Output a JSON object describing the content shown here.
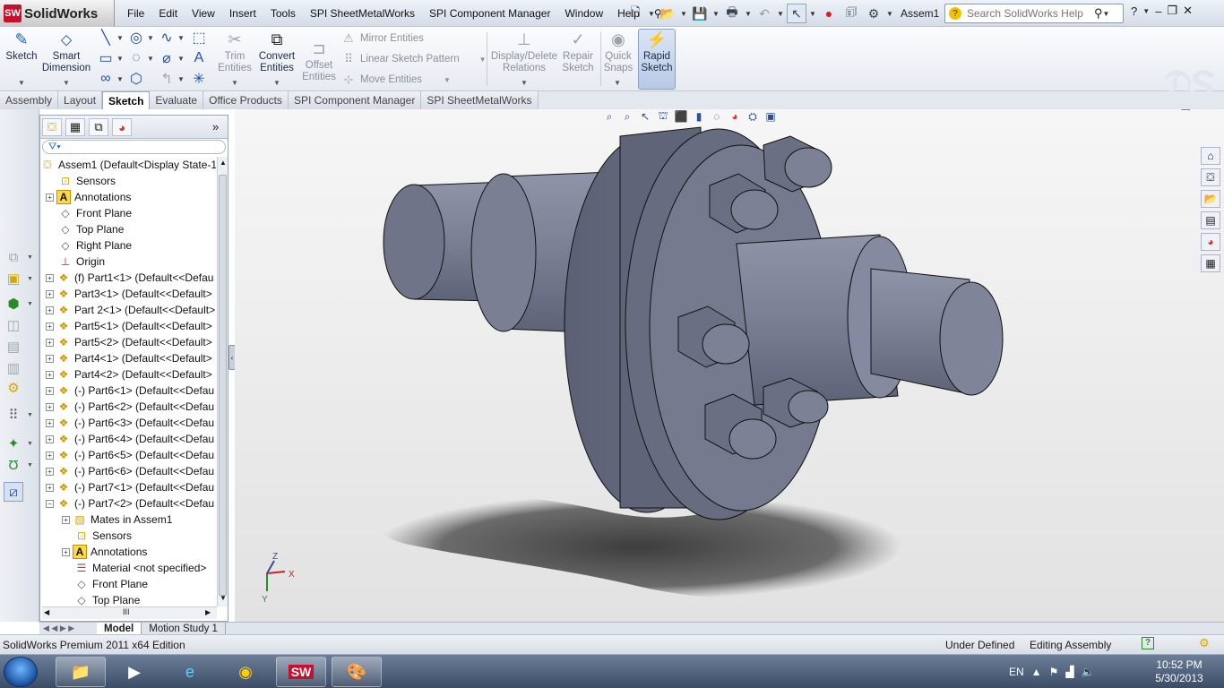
{
  "app": {
    "brand": "SolidWorks",
    "logo_letters": "SW"
  },
  "menu": [
    "File",
    "Edit",
    "View",
    "Insert",
    "Tools",
    "SPI SheetMetalWorks",
    "SPI Component Manager",
    "Window",
    "Help"
  ],
  "document_title": "Assem1",
  "search": {
    "placeholder": "Search SolidWorks Help"
  },
  "ribbon": {
    "sketch": "Sketch",
    "smart_dimension_1": "Smart",
    "smart_dimension_2": "Dimension",
    "trim_1": "Trim",
    "trim_2": "Entities",
    "convert_1": "Convert",
    "convert_2": "Entities",
    "offset_1": "Offset",
    "offset_2": "Entities",
    "mirror": "Mirror Entities",
    "linear_pattern": "Linear Sketch Pattern",
    "move": "Move Entities",
    "display_delete_1": "Display/Delete",
    "display_delete_2": "Relations",
    "repair_1": "Repair",
    "repair_2": "Sketch",
    "quick_snaps_1": "Quick",
    "quick_snaps_2": "Snaps",
    "rapid_1": "Rapid",
    "rapid_2": "Sketch"
  },
  "command_tabs": [
    "Assembly",
    "Layout",
    "Sketch",
    "Evaluate",
    "Office Products",
    "SPI Component Manager",
    "SPI SheetMetalWorks"
  ],
  "active_tab": "Sketch",
  "tree": {
    "root": "Assem1  (Default<Display State-1",
    "items": [
      {
        "label": "Sensors",
        "icon": "sensor-icon"
      },
      {
        "label": "Annotations",
        "icon": "annotations-icon"
      },
      {
        "label": "Front Plane",
        "icon": "plane-icon"
      },
      {
        "label": "Top Plane",
        "icon": "plane-icon"
      },
      {
        "label": "Right Plane",
        "icon": "plane-icon"
      },
      {
        "label": "Origin",
        "icon": "origin-icon"
      },
      {
        "label": "(f) Part1<1> (Default<<Defau",
        "icon": "part-icon"
      },
      {
        "label": "Part3<1> (Default<<Default>",
        "icon": "part-icon"
      },
      {
        "label": "Part 2<1> (Default<<Default>",
        "icon": "part-icon"
      },
      {
        "label": "Part5<1> (Default<<Default>",
        "icon": "part-icon"
      },
      {
        "label": "Part5<2> (Default<<Default>",
        "icon": "part-icon"
      },
      {
        "label": "Part4<1> (Default<<Default>",
        "icon": "part-icon"
      },
      {
        "label": "Part4<2> (Default<<Default>",
        "icon": "part-icon"
      },
      {
        "label": "(-) Part6<1> (Default<<Defau",
        "icon": "part-icon"
      },
      {
        "label": "(-) Part6<2> (Default<<Defau",
        "icon": "part-icon"
      },
      {
        "label": "(-) Part6<3> (Default<<Defau",
        "icon": "part-icon"
      },
      {
        "label": "(-) Part6<4> (Default<<Defau",
        "icon": "part-icon"
      },
      {
        "label": "(-) Part6<5> (Default<<Defau",
        "icon": "part-icon"
      },
      {
        "label": "(-) Part6<6> (Default<<Defau",
        "icon": "part-icon"
      },
      {
        "label": "(-) Part7<1> (Default<<Defau",
        "icon": "part-icon"
      },
      {
        "label": "(-) Part7<2> (Default<<Defau",
        "icon": "part-icon"
      }
    ],
    "sub_items": [
      {
        "label": "Mates in Assem1",
        "icon": "mates-icon"
      },
      {
        "label": "Sensors",
        "icon": "sensor-icon"
      },
      {
        "label": "Annotations",
        "icon": "annotations-icon"
      },
      {
        "label": "Material <not specified>",
        "icon": "material-icon"
      },
      {
        "label": "Front Plane",
        "icon": "plane-icon"
      },
      {
        "label": "Top Plane",
        "icon": "plane-icon"
      }
    ]
  },
  "bottom_tabs": [
    "Model",
    "Motion Study 1"
  ],
  "status": {
    "edition": "SolidWorks Premium 2011 x64 Edition",
    "state": "Under Defined",
    "mode": "Editing Assembly"
  },
  "triad": {
    "x": "X",
    "y": "Y",
    "z": "Z"
  },
  "tray": {
    "lang": "EN",
    "time": "10:52 PM",
    "date": "5/30/2013"
  },
  "colors": {
    "part": "#7b7f93",
    "part_dark": "#555a6e",
    "part_light": "#9aa0b3",
    "shadow": "#4a4a4a"
  }
}
